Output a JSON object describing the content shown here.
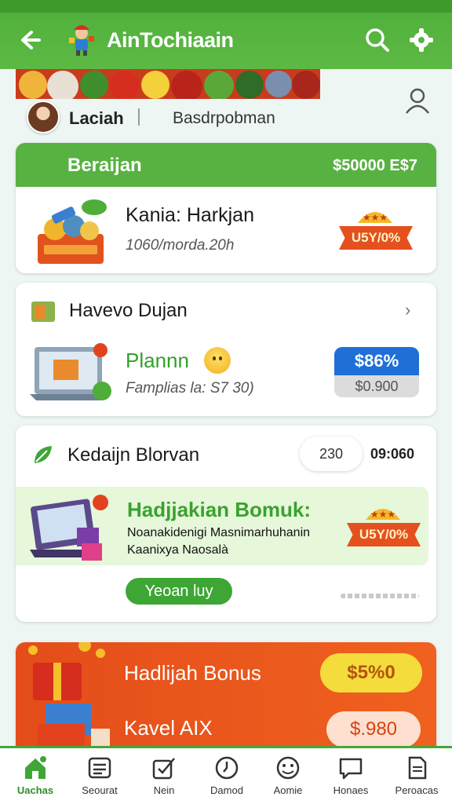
{
  "colors": {
    "primary_green": "#58b242",
    "accent_orange": "#e5501f",
    "price_blue": "#1f6fd6",
    "highlight_yellow": "#f4dc3c"
  },
  "header": {
    "title": "AinTochiaain",
    "icons": [
      "back-arrow-icon",
      "app-logo-icon",
      "search-icon",
      "gear-icon"
    ]
  },
  "profile": {
    "name": "Laciah",
    "subtitle": "Basdrpobman"
  },
  "card1": {
    "header_title": "Beraijan",
    "header_value": "$50000 E$7",
    "item_title": "Kania: Harkjan",
    "item_subtitle": "1060/morda.20h",
    "ribbon_text": "U5Y/0%"
  },
  "card2": {
    "title": "Havevo Dujan",
    "item_title": "Plannn",
    "item_subtitle": "Famplias la: S7 30)",
    "price": "$86%",
    "old_price": "$0.900"
  },
  "card3": {
    "title": "Kedaijn Blorvan",
    "pill": "230",
    "timer": "09:060",
    "promo_title": "Hadjjakian Bomuk:",
    "promo_line1": "Noanakidenigi Masnimarhuhanin",
    "promo_line2": "Kaanixya Naosalà",
    "ribbon_text": "U5Y/0%",
    "button_label": "Yeoan luy"
  },
  "card4": {
    "title1": "Hadlijah Bonus",
    "title2": "Kavel AIX",
    "price1": "$5%0",
    "price2": "$.980"
  },
  "nav": [
    {
      "label": "Uachas",
      "icon": "home-icon",
      "active": true
    },
    {
      "label": "Seourat",
      "icon": "list-icon",
      "active": false
    },
    {
      "label": "Nein",
      "icon": "edit-check-icon",
      "active": false
    },
    {
      "label": "Damod",
      "icon": "clock-icon",
      "active": false
    },
    {
      "label": "Aomie",
      "icon": "social-icon",
      "active": false
    },
    {
      "label": "Honaes",
      "icon": "chat-icon",
      "active": false
    },
    {
      "label": "Peroacas",
      "icon": "document-icon",
      "active": false
    }
  ]
}
